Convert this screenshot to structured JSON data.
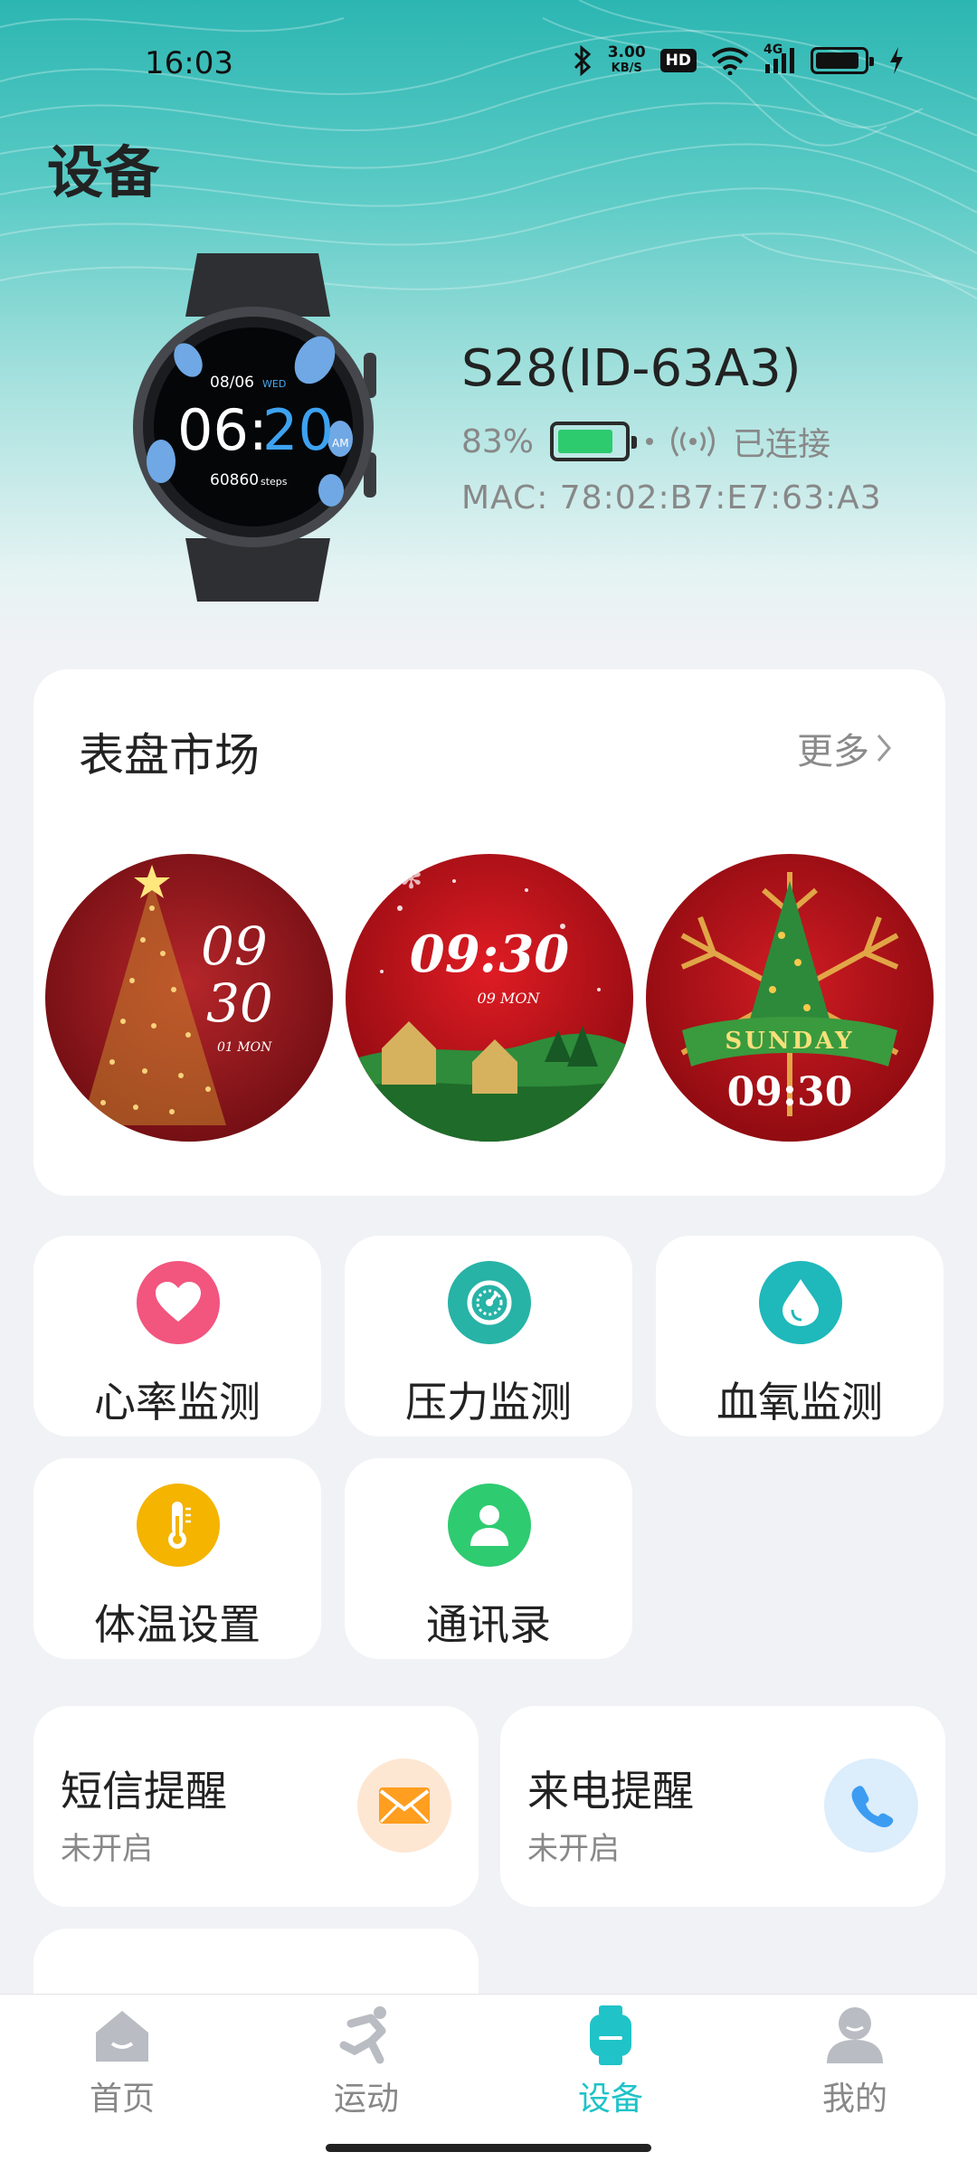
{
  "status_bar": {
    "time": "16:03",
    "net_speed_value": "3.00",
    "net_speed_unit": "KB/S",
    "hd_label": "HD",
    "signal_label": "4G",
    "battery_level": 0.9
  },
  "page_title": "设备",
  "device": {
    "name": "S28(ID-63A3)",
    "battery_percent": "83%",
    "battery_level": 0.83,
    "connection_status": "已连接",
    "mac_label": "MAC:",
    "mac": "78:02:B7:E7:63:A3",
    "watch_screen": {
      "date": "08/06",
      "weekday": "WED",
      "hour": "06:",
      "minute": "20",
      "ampm": "AM",
      "steps": "60860",
      "steps_unit": "steps"
    }
  },
  "watch_face_market": {
    "title": "表盘市场",
    "more_label": "更多",
    "faces": [
      {
        "name": "christmas-tree-face",
        "line1": "09",
        "line2": "30",
        "date": "01 MON"
      },
      {
        "name": "christmas-village-face",
        "time": "09:30",
        "date": "09 MON"
      },
      {
        "name": "christmas-sunday-face",
        "banner": "SUNDAY",
        "time": "09:30"
      }
    ]
  },
  "features": [
    {
      "label": "心率监测",
      "icon": "heart-icon",
      "color": "#f2557e"
    },
    {
      "label": "压力监测",
      "icon": "gauge-icon",
      "color": "#27b3a6"
    },
    {
      "label": "血氧监测",
      "icon": "droplet-icon",
      "color": "#1fb8bb"
    },
    {
      "label": "体温设置",
      "icon": "thermometer-icon",
      "color": "#f4b400"
    },
    {
      "label": "通讯录",
      "icon": "contact-icon",
      "color": "#2ecb71"
    }
  ],
  "reminders": [
    {
      "title": "短信提醒",
      "status": "未开启",
      "icon": "envelope-icon",
      "color": "#ff9e1f"
    },
    {
      "title": "来电提醒",
      "status": "未开启",
      "icon": "phone-icon",
      "color": "#3c9cf2"
    }
  ],
  "bottom_nav": [
    {
      "label": "首页",
      "icon": "home-icon",
      "active": false
    },
    {
      "label": "运动",
      "icon": "running-icon",
      "active": false
    },
    {
      "label": "设备",
      "icon": "watch-icon",
      "active": true
    },
    {
      "label": "我的",
      "icon": "profile-icon",
      "active": false
    }
  ]
}
